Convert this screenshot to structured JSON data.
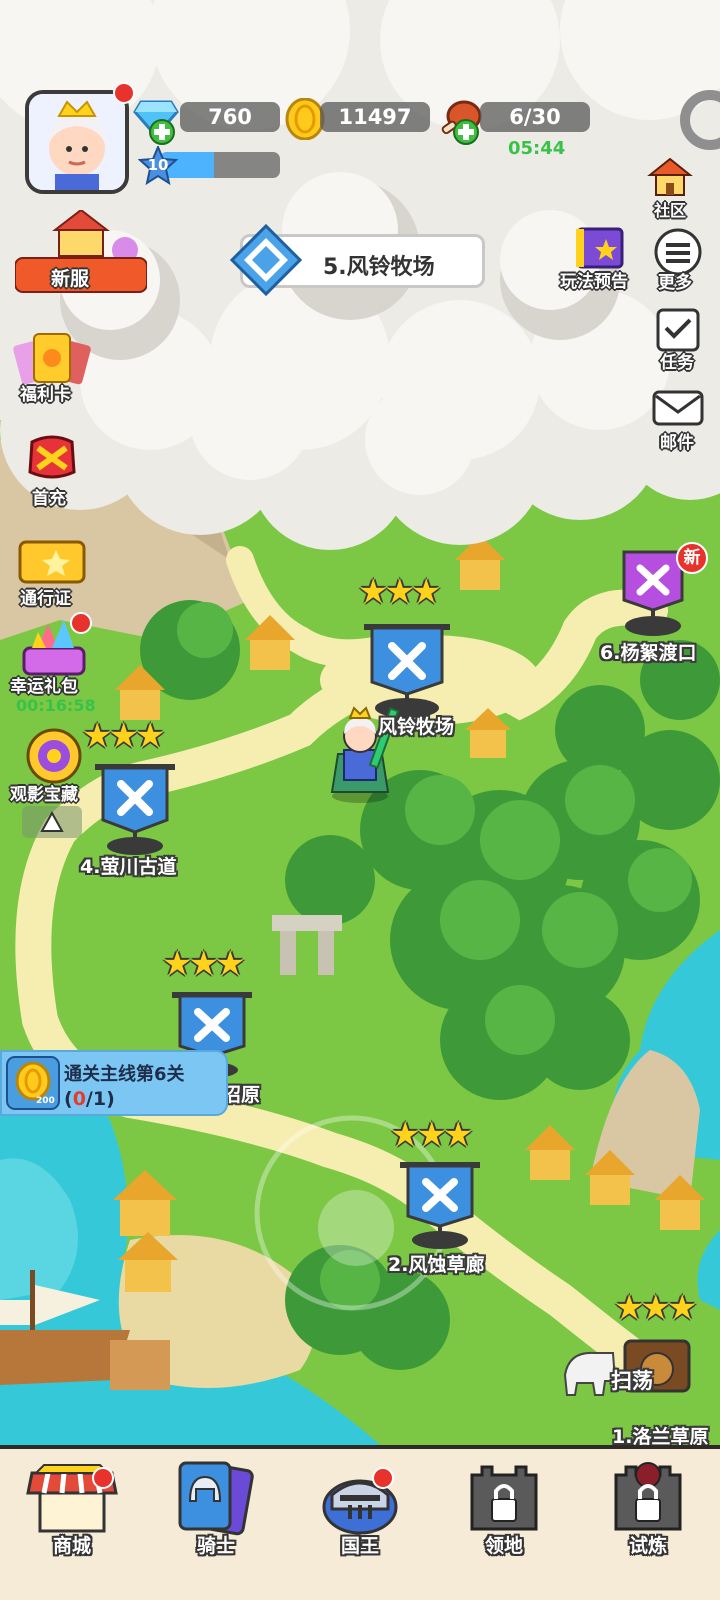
{
  "hud": {
    "gems": "760",
    "coins": "11497",
    "stamina": "6/30",
    "stamina_timer": "05:44",
    "level": "10",
    "level_progress": 0.45
  },
  "stage_title": "5.风铃牧场",
  "left_menu": [
    {
      "label": "福利卡"
    },
    {
      "label": "首充"
    },
    {
      "label": "通行证"
    },
    {
      "label": "幸运礼包",
      "timer": "00:16:58"
    },
    {
      "label": "观影宝藏"
    }
  ],
  "new_server_label": "新服",
  "right_menu": [
    {
      "label": "社区"
    },
    {
      "label": "玩法预告"
    },
    {
      "label": "更多"
    },
    {
      "label": "任务"
    },
    {
      "label": "邮件"
    }
  ],
  "stages": [
    {
      "label": "6.杨絮渡口",
      "badge": "新"
    },
    {
      "label": "风铃牧场",
      "stars": 3
    },
    {
      "label": "4.萤川古道",
      "stars": 3
    },
    {
      "label": "沼原",
      "stars": 3
    },
    {
      "label": "2.风蚀草廊",
      "stars": 3
    },
    {
      "label": "1.洛兰草原",
      "stars": 3
    }
  ],
  "quest": {
    "title": "通关主线第6关",
    "open": "(",
    "current": "0",
    "total": "/1)",
    "coin_value": "200"
  },
  "sweep_label": "扫荡",
  "bottom_nav": [
    {
      "label": "商城",
      "dot": true
    },
    {
      "label": "骑士",
      "dot": false
    },
    {
      "label": "国王",
      "dot": true
    },
    {
      "label": "领地",
      "locked": true
    },
    {
      "label": "试炼",
      "locked": true
    }
  ],
  "colors": {
    "grass": "#7cc845",
    "path": "#f6eeb0",
    "water": "#35c8d8",
    "banner_blue": "#3d8fe0",
    "banner_purple": "#b64fe0",
    "star": "#ffd21c",
    "alert_red": "#e8322c"
  }
}
